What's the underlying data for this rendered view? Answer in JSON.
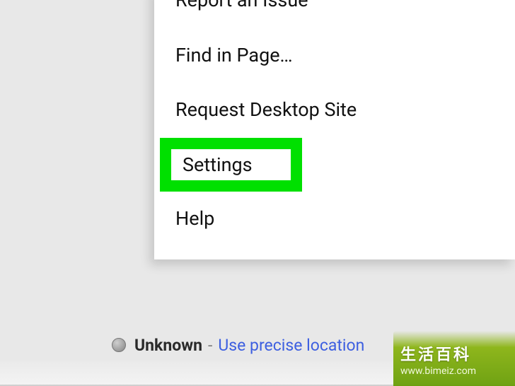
{
  "menu": {
    "items": [
      {
        "label": "Report an Issue",
        "name": "menu-item-report-issue"
      },
      {
        "label": "Find in Page…",
        "name": "menu-item-find-in-page"
      },
      {
        "label": "Request Desktop Site",
        "name": "menu-item-request-desktop"
      },
      {
        "label": "Settings",
        "name": "menu-item-settings",
        "highlighted": true
      },
      {
        "label": "Help",
        "name": "menu-item-help"
      }
    ]
  },
  "location": {
    "status": "Unknown",
    "separator": "-",
    "link": "Use precise location"
  },
  "watermark": {
    "title": "生活百科",
    "url": "www.bimeiz.com"
  },
  "highlight_color": "#00e000"
}
